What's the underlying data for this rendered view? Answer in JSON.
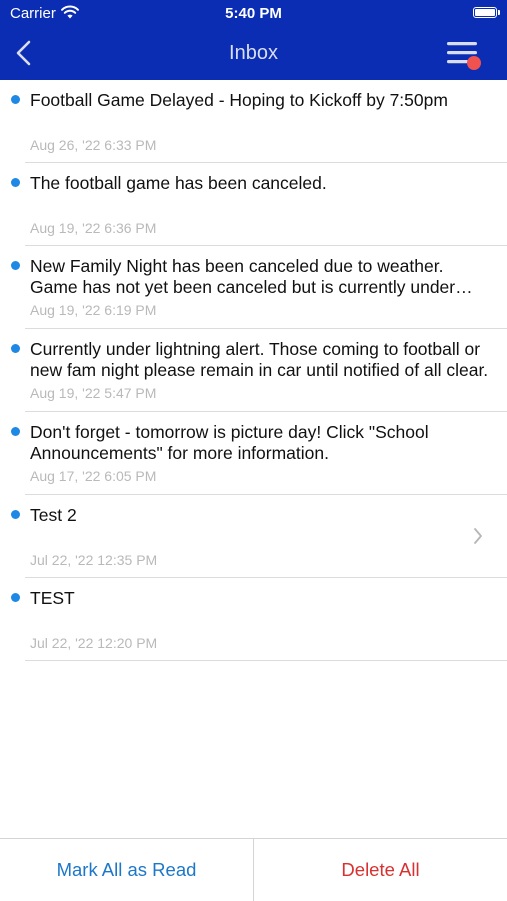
{
  "status_bar": {
    "carrier": "Carrier",
    "time": "5:40 PM",
    "icons": [
      "wifi-icon",
      "battery-icon"
    ]
  },
  "nav": {
    "title": "Inbox",
    "back_icon": "chevron-left-icon",
    "menu_icon": "menu-with-badge-icon"
  },
  "colors": {
    "nav_bar": "#0a2db3",
    "unread_dot": "#1e88e5",
    "mark_all": "#1d77c9",
    "delete_all": "#d93030",
    "badge": "#f0524f"
  },
  "messages": [
    {
      "text": "Football Game Delayed - Hoping to Kickoff by 7:50pm",
      "date": "Aug 26, '22 6:33 PM",
      "unread": true
    },
    {
      "text": "The football game has been canceled.",
      "date": "Aug 19, '22 6:36 PM",
      "unread": true
    },
    {
      "text": "New Family Night has been canceled due to weather. Game has not yet been canceled but is currently under lightning alert.",
      "date": "Aug 19, '22 6:19 PM",
      "unread": true
    },
    {
      "text": "Currently under lightning alert. Those coming to football or new fam night please remain in car until notified of all clear.",
      "date": "Aug 19, '22 5:47 PM",
      "unread": true
    },
    {
      "text": "Don't forget - tomorrow is picture day! Click \"School Announcements\" for more information.",
      "date": "Aug 17, '22 6:05 PM",
      "unread": true
    },
    {
      "text": "Test 2",
      "date": "Jul 22, '22 12:35 PM",
      "unread": true
    },
    {
      "text": "TEST",
      "date": "Jul 22, '22 12:20 PM",
      "unread": true
    }
  ],
  "footer": {
    "mark_all_label": "Mark All as Read",
    "delete_all_label": "Delete All"
  }
}
